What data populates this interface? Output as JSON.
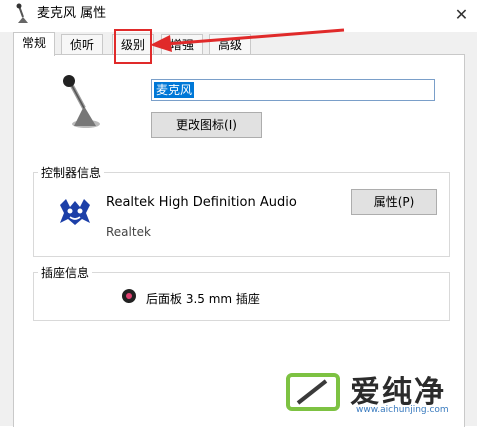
{
  "window": {
    "title": "麦克风 属性",
    "close_glyph": "✕"
  },
  "tabs": [
    {
      "label": "常规",
      "active": true
    },
    {
      "label": "侦听",
      "active": false
    },
    {
      "label": "级别",
      "active": false
    },
    {
      "label": "增强",
      "active": false
    },
    {
      "label": "高级",
      "active": false
    }
  ],
  "general": {
    "name_value": "麦克风",
    "change_icon_label": "更改图标(I)"
  },
  "controller": {
    "group_label": "控制器信息",
    "device_name": "Realtek High Definition Audio",
    "vendor": "Realtek",
    "properties_label": "属性(P)"
  },
  "jack": {
    "group_label": "插座信息",
    "label": "后面板 3.5 mm 插座"
  },
  "annotation": {
    "color": "#e02a2a"
  },
  "watermark": {
    "title": "爱纯净",
    "url": "www.aichunjing.com"
  },
  "icons": [
    "microphone-icon",
    "realtek-logo-icon",
    "jack-icon",
    "close-icon"
  ]
}
